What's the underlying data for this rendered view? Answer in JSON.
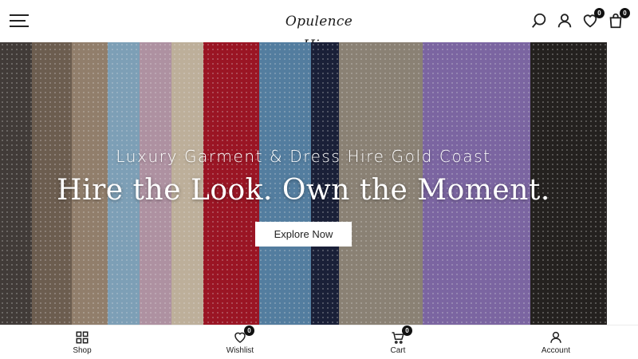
{
  "header": {
    "logo_text": "Opulence Hire",
    "wishlist_count": "0",
    "cart_count": "0"
  },
  "hero": {
    "subtitle": "Luxury Garment & Dress Hire Gold Coast",
    "title": "Hire the Look. Own the Moment.",
    "cta_label": "Explore Now"
  },
  "bottom_nav": {
    "items": [
      {
        "label": "Shop",
        "icon": "grid-icon"
      },
      {
        "label": "Wishlist",
        "icon": "heart-icon",
        "badge": "0"
      },
      {
        "label": "Cart",
        "icon": "cart-icon",
        "badge": "0"
      },
      {
        "label": "Account",
        "icon": "user-icon"
      }
    ]
  },
  "colors": {
    "text": "#222222",
    "badge": "#111111",
    "button_bg": "#ffffff"
  }
}
